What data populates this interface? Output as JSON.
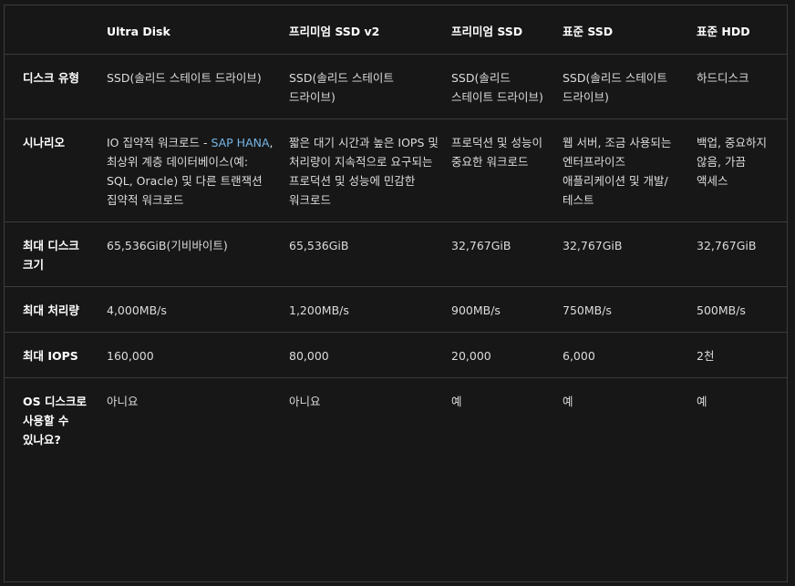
{
  "table": {
    "headers": [
      "",
      "Ultra Disk",
      "프리미엄 SSD v2",
      "프리미엄 SSD",
      "표준 SSD",
      "표준 HDD"
    ],
    "rows": [
      {
        "label": "디스크 유형",
        "cells": [
          "SSD(솔리드 스테이트 드라이브)",
          "SSD(솔리드 스테이트 드라이브)",
          "SSD(솔리드 스테이트 드라이브)",
          "SSD(솔리드 스테이트 드라이브)",
          "하드디스크"
        ]
      },
      {
        "label": "시나리오",
        "ultra_prefix": "IO 집약적 워크로드 - ",
        "ultra_link": "SAP HANA",
        "ultra_suffix": ", 최상위 계층 데이터베이스(예: SQL, Oracle) 및 다른 트랜잭션 집약적 워크로드",
        "cells": [
          "",
          "짧은 대기 시간과 높은 IOPS 및 처리량이 지속적으로 요구되는 프로덕션 및 성능에 민감한 워크로드",
          "프로덕션 및 성능이 중요한 워크로드",
          "웹 서버, 조금 사용되는 엔터프라이즈 애플리케이션 및 개발/테스트",
          "백업, 중요하지 않음, 가끔 액세스"
        ]
      },
      {
        "label": "최대 디스크 크기",
        "cells": [
          "65,536GiB(기비바이트)",
          "65,536GiB",
          "32,767GiB",
          "32,767GiB",
          "32,767GiB"
        ]
      },
      {
        "label": "최대 처리량",
        "cells": [
          "4,000MB/s",
          "1,200MB/s",
          "900MB/s",
          "750MB/s",
          "500MB/s"
        ]
      },
      {
        "label": "최대 IOPS",
        "cells": [
          "160,000",
          "80,000",
          "20,000",
          "6,000",
          "2천"
        ]
      },
      {
        "label": "OS 디스크로 사용할 수 있나요?",
        "cells": [
          "아니요",
          "아니요",
          "예",
          "예",
          "예"
        ]
      }
    ]
  }
}
